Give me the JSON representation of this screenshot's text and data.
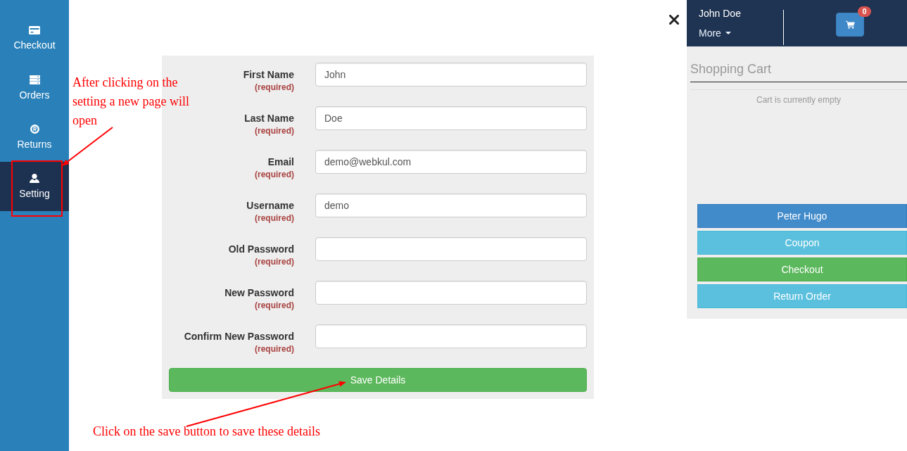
{
  "sidebar": {
    "items": [
      {
        "label": "Checkout",
        "selected": false
      },
      {
        "label": "Orders",
        "selected": false
      },
      {
        "label": "Returns",
        "selected": false
      },
      {
        "label": "Setting",
        "selected": true
      }
    ]
  },
  "settings_form": {
    "fields": [
      {
        "label": "First Name",
        "note": "(required)",
        "value": "John"
      },
      {
        "label": "Last Name",
        "note": "(required)",
        "value": "Doe"
      },
      {
        "label": "Email",
        "note": "(required)",
        "value": "demo@webkul.com"
      },
      {
        "label": "Username",
        "note": "(required)",
        "value": "demo"
      },
      {
        "label": "Old Password",
        "note": "(required)"
      },
      {
        "label": "New Password",
        "note": "(required)"
      },
      {
        "label": "Confirm New Password",
        "note": "(required)"
      }
    ],
    "save_button": "Save Details"
  },
  "cart_panel": {
    "user_name": "John Doe",
    "more_menu": "More",
    "cart_count": "0",
    "title": "Shopping Cart",
    "empty_message": "Cart is currently empty",
    "buttons": [
      {
        "label": "Peter Hugo",
        "kind": "primary"
      },
      {
        "label": "Coupon",
        "kind": "info"
      },
      {
        "label": "Checkout",
        "kind": "success"
      },
      {
        "label": "Return Order",
        "kind": "info"
      }
    ]
  },
  "annotations": [
    {
      "text": "After clicking on the setting a new page will open"
    },
    {
      "text": "Click on the save button to save these details"
    }
  ]
}
